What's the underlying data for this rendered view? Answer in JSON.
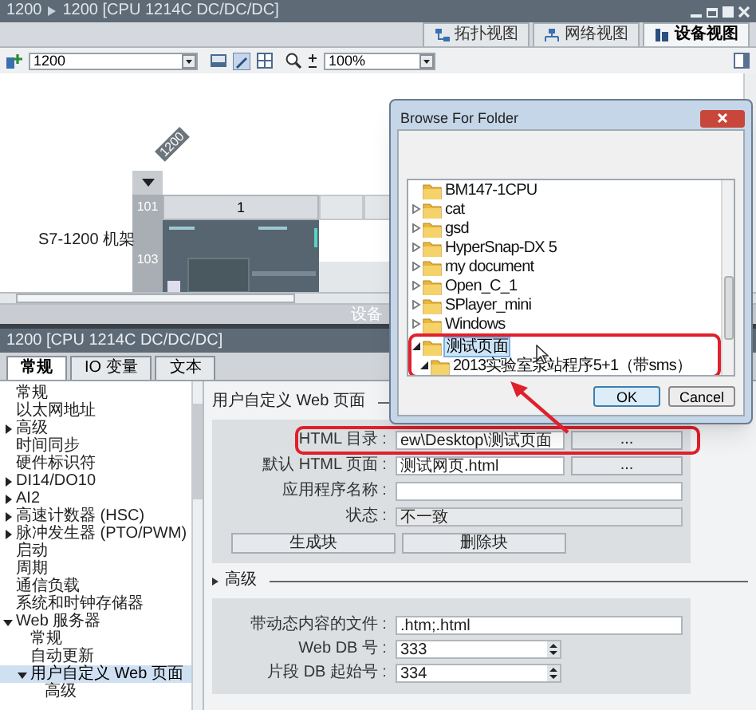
{
  "window": {
    "breadcrumb": [
      "1200",
      "1200 [CPU 1214C DC/DC/DC]"
    ]
  },
  "view_tabs": [
    {
      "label": "拓扑视图",
      "selected": false
    },
    {
      "label": "网络视图",
      "selected": false
    },
    {
      "label": "设备视图",
      "selected": true
    }
  ],
  "toolbar": {
    "device": "1200",
    "zoom": "100%"
  },
  "canvas": {
    "device_label": "1200",
    "rack_label": "S7-1200 机架",
    "header_cell": "101",
    "slot": "1",
    "row_label": "103"
  },
  "strip_tab": "设备",
  "inspector": {
    "title": "1200 [CPU 1214C DC/DC/DC]",
    "tabs": [
      {
        "label": "常规",
        "selected": true
      },
      {
        "label": "IO 变量",
        "selected": false
      },
      {
        "label": "文本",
        "selected": false
      }
    ],
    "tree": [
      {
        "children": [
          {
            "label": "常规",
            "selected": false,
            "expandable": false
          },
          {
            "label": "以太网地址",
            "selected": false,
            "expandable": false
          },
          {
            "label": "高级",
            "selected": false,
            "expandable": true,
            "expanded": false
          },
          {
            "label": "时间同步",
            "selected": false,
            "expandable": false
          },
          {
            "label": "硬件标识符",
            "selected": false,
            "expandable": false
          }
        ]
      },
      {
        "label": "DI14/DO10",
        "selected": false,
        "expandable": true,
        "expanded": false
      },
      {
        "label": "AI2",
        "selected": false,
        "expandable": true,
        "expanded": false
      },
      {
        "label": "高速计数器 (HSC)",
        "selected": false,
        "expandable": true,
        "expanded": false
      },
      {
        "label": "脉冲发生器 (PTO/PWM)",
        "selected": false,
        "expandable": true,
        "expanded": false
      },
      {
        "label": "启动",
        "selected": false,
        "expandable": false
      },
      {
        "label": "周期",
        "selected": false,
        "expandable": false
      },
      {
        "label": "通信负载",
        "selected": false,
        "expandable": false
      },
      {
        "label": "系统和时钟存储器",
        "selected": false,
        "expandable": false
      },
      {
        "label": "Web 服务器",
        "selected": false,
        "expandable": true,
        "expanded": true,
        "children": [
          {
            "label": "常规",
            "selected": false,
            "expandable": false
          },
          {
            "label": "自动更新",
            "selected": false,
            "expandable": false
          },
          {
            "label": "用户自定义 Web 页面",
            "selected": true,
            "expandable": true,
            "expanded": true,
            "children": [
              {
                "label": "高级",
                "selected": false,
                "expandable": false
              }
            ]
          }
        ]
      }
    ],
    "section": "用户自定义 Web 页面",
    "fields": [
      {
        "label": "HTML 目录",
        "colon": ":",
        "kind": "browse",
        "value": "ew\\Desktop\\测试页面",
        "button": "..."
      },
      {
        "label": "默认 HTML 页面",
        "colon": ":",
        "kind": "browse",
        "value": "测试网页.html",
        "button": "..."
      },
      {
        "label": "应用程序名称",
        "colon": ":",
        "kind": "input"
      },
      {
        "label": "状态",
        "colon": ":",
        "kind": "readonly",
        "value": "不一致"
      }
    ],
    "buttons": [
      "生成块",
      "删除块"
    ],
    "advanced": {
      "title": "高级",
      "fields": [
        {
          "label": "带动态内容的文件",
          "colon": ":",
          "kind": "input",
          "value": ".htm;.html"
        },
        {
          "label": "Web DB 号",
          "colon": ":",
          "kind": "spin",
          "value": "333"
        },
        {
          "label": "片段 DB 起始号",
          "colon": ":",
          "kind": "spin",
          "value": "334"
        }
      ]
    }
  },
  "dialog": {
    "title": "Browse For Folder",
    "folders": [
      {
        "label": "BM147-1CPU",
        "expandable": false,
        "selected": false
      },
      {
        "label": "cat",
        "expandable": true,
        "expanded": false,
        "selected": false
      },
      {
        "label": "gsd",
        "expandable": true,
        "expanded": false,
        "selected": false
      },
      {
        "label": "HyperSnap-DX 5",
        "expandable": true,
        "expanded": false,
        "selected": false
      },
      {
        "label": "my document",
        "expandable": true,
        "expanded": false,
        "selected": false
      },
      {
        "label": "Open_C_1",
        "expandable": true,
        "expanded": false,
        "selected": false
      },
      {
        "label": "SPlayer_mini",
        "expandable": true,
        "expanded": false,
        "selected": false
      },
      {
        "label": "Windows",
        "expandable": true,
        "expanded": false,
        "selected": false
      },
      {
        "label": "测试页面",
        "expandable": true,
        "expanded": true,
        "selected": true,
        "children": [
          {
            "label": "2013实验室泵站程序5+1（带sms）",
            "expandable": true,
            "expanded": true,
            "selected": false
          }
        ]
      }
    ],
    "buttons": [
      "OK",
      "Cancel"
    ]
  }
}
